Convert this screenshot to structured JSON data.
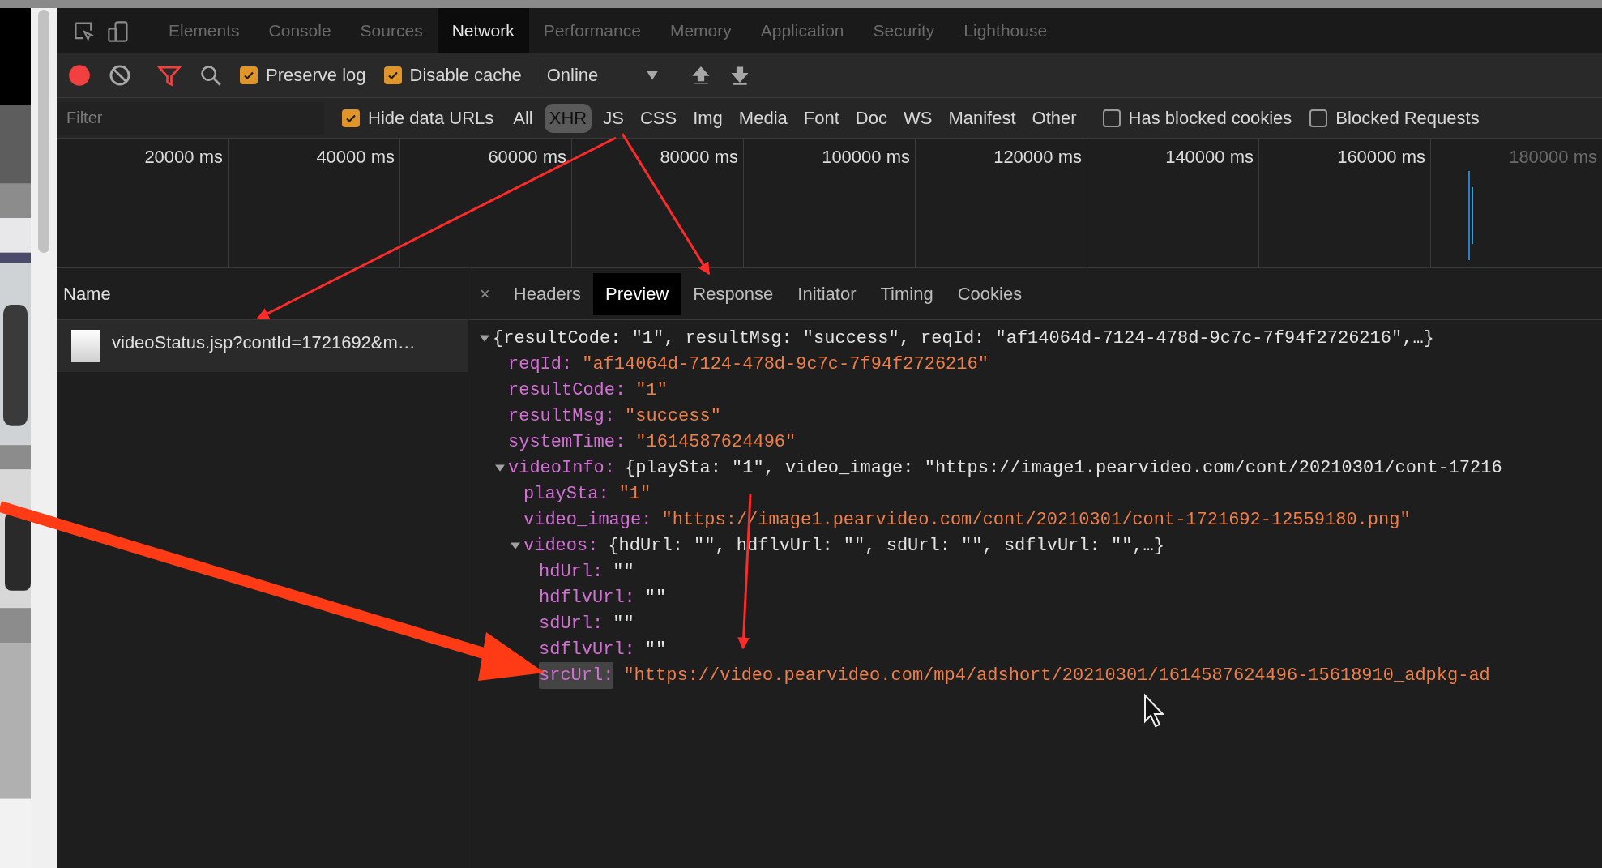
{
  "panel_tabs": [
    {
      "label": "Elements",
      "selected": false
    },
    {
      "label": "Console",
      "selected": false
    },
    {
      "label": "Sources",
      "selected": false
    },
    {
      "label": "Network",
      "selected": true
    },
    {
      "label": "Performance",
      "selected": false
    },
    {
      "label": "Memory",
      "selected": false
    },
    {
      "label": "Application",
      "selected": false
    },
    {
      "label": "Security",
      "selected": false
    },
    {
      "label": "Lighthouse",
      "selected": false
    }
  ],
  "toolbar": {
    "recording": true,
    "checkboxes": [
      {
        "label": "Preserve log",
        "checked": true
      },
      {
        "label": "Disable cache",
        "checked": true
      }
    ],
    "throttling": "Online"
  },
  "filter_bar": {
    "placeholder": "Filter",
    "hide_data_urls": {
      "label": "Hide data URLs",
      "checked": true
    },
    "types": [
      {
        "label": "All",
        "selected": false
      },
      {
        "label": "XHR",
        "selected": true
      },
      {
        "label": "JS",
        "selected": false
      },
      {
        "label": "CSS",
        "selected": false
      },
      {
        "label": "Img",
        "selected": false
      },
      {
        "label": "Media",
        "selected": false
      },
      {
        "label": "Font",
        "selected": false
      },
      {
        "label": "Doc",
        "selected": false
      },
      {
        "label": "WS",
        "selected": false
      },
      {
        "label": "Manifest",
        "selected": false
      },
      {
        "label": "Other",
        "selected": false
      }
    ],
    "options": [
      {
        "label": "Has blocked cookies",
        "checked": false
      },
      {
        "label": "Blocked Requests",
        "checked": false
      }
    ]
  },
  "timeline": {
    "ticks": [
      "20000 ms",
      "40000 ms",
      "60000 ms",
      "80000 ms",
      "100000 ms",
      "120000 ms",
      "140000 ms",
      "160000 ms",
      "180000 ms"
    ]
  },
  "requests": {
    "column": "Name",
    "rows": [
      {
        "name": "videoStatus.jsp?contId=1721692&m…",
        "selected": true
      }
    ]
  },
  "detail_tabs": {
    "close": "×",
    "tabs": [
      {
        "label": "Headers",
        "selected": false
      },
      {
        "label": "Preview",
        "selected": true
      },
      {
        "label": "Response",
        "selected": false
      },
      {
        "label": "Initiator",
        "selected": false
      },
      {
        "label": "Timing",
        "selected": false
      },
      {
        "label": "Cookies",
        "selected": false
      }
    ]
  },
  "preview": {
    "summary": "{resultCode: \"1\", resultMsg: \"success\", reqId: \"af14064d-7124-478d-9c7c-7f94f2726216\",…}",
    "expanded": true,
    "children": [
      {
        "key": "reqId:",
        "value": "\"af14064d-7124-478d-9c7c-7f94f2726216\"",
        "highlighted": false
      },
      {
        "key": "resultCode:",
        "value": "\"1\"",
        "highlighted": false
      },
      {
        "key": "resultMsg:",
        "value": "\"success\"",
        "highlighted": false
      },
      {
        "key": "systemTime:",
        "value": "\"1614587624496\"",
        "highlighted": false
      },
      {
        "key": "videoInfo:",
        "summary": "{playSta: \"1\", video_image: \"https://image1.pearvideo.com/cont/20210301/cont-17216",
        "expanded": true,
        "highlighted": false,
        "children": [
          {
            "key": "playSta:",
            "value": "\"1\"",
            "highlighted": false
          },
          {
            "key": "video_image:",
            "value": "\"https://image1.pearvideo.com/cont/20210301/cont-1721692-12559180.png\"",
            "highlighted": false
          },
          {
            "key": "videos:",
            "summary": "{hdUrl: \"\", hdflvUrl: \"\", sdUrl: \"\", sdflvUrl: \"\",…}",
            "expanded": true,
            "highlighted": false,
            "children": [
              {
                "key": "hdUrl:",
                "value": "\"\"",
                "highlighted": false
              },
              {
                "key": "hdflvUrl:",
                "value": "\"\"",
                "highlighted": false
              },
              {
                "key": "sdUrl:",
                "value": "\"\"",
                "highlighted": false
              },
              {
                "key": "sdflvUrl:",
                "value": "\"\"",
                "highlighted": false
              },
              {
                "key": "srcUrl:",
                "value": "\"https://video.pearvideo.com/mp4/adshort/20210301/1614587624496-15618910_adpkg-ad",
                "highlighted": true
              }
            ]
          }
        ]
      }
    ]
  }
}
